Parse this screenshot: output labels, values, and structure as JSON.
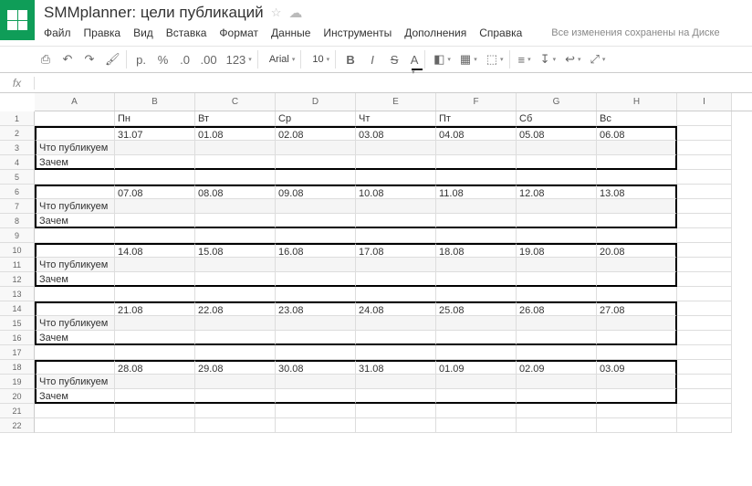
{
  "doc": {
    "title": "SMMplanner: цели публикаций",
    "save_msg": "Все изменения сохранены на Диске"
  },
  "menu": [
    "Файл",
    "Правка",
    "Вид",
    "Вставка",
    "Формат",
    "Данные",
    "Инструменты",
    "Дополнения",
    "Справка"
  ],
  "toolbar": {
    "currency": "р.",
    "percent": "%",
    "decrease": ".0",
    "increase": ".00",
    "numfmt": "123",
    "font": "Arial",
    "size": "10",
    "bold": "B",
    "italic": "I",
    "strike": "S",
    "color": "A"
  },
  "fx": "fx",
  "cols": [
    "A",
    "B",
    "C",
    "D",
    "E",
    "F",
    "G",
    "H",
    "I"
  ],
  "days": [
    "Пн",
    "Вт",
    "Ср",
    "Чт",
    "Пт",
    "Сб",
    "Вс"
  ],
  "labels": {
    "what": "Что публикуем",
    "why": "Зачем"
  },
  "weeks": [
    [
      "31.07",
      "01.08",
      "02.08",
      "03.08",
      "04.08",
      "05.08",
      "06.08"
    ],
    [
      "07.08",
      "08.08",
      "09.08",
      "10.08",
      "11.08",
      "12.08",
      "13.08"
    ],
    [
      "14.08",
      "15.08",
      "16.08",
      "17.08",
      "18.08",
      "19.08",
      "20.08"
    ],
    [
      "21.08",
      "22.08",
      "23.08",
      "24.08",
      "25.08",
      "26.08",
      "27.08"
    ],
    [
      "28.08",
      "29.08",
      "30.08",
      "31.08",
      "01.09",
      "02.09",
      "03.09"
    ]
  ]
}
